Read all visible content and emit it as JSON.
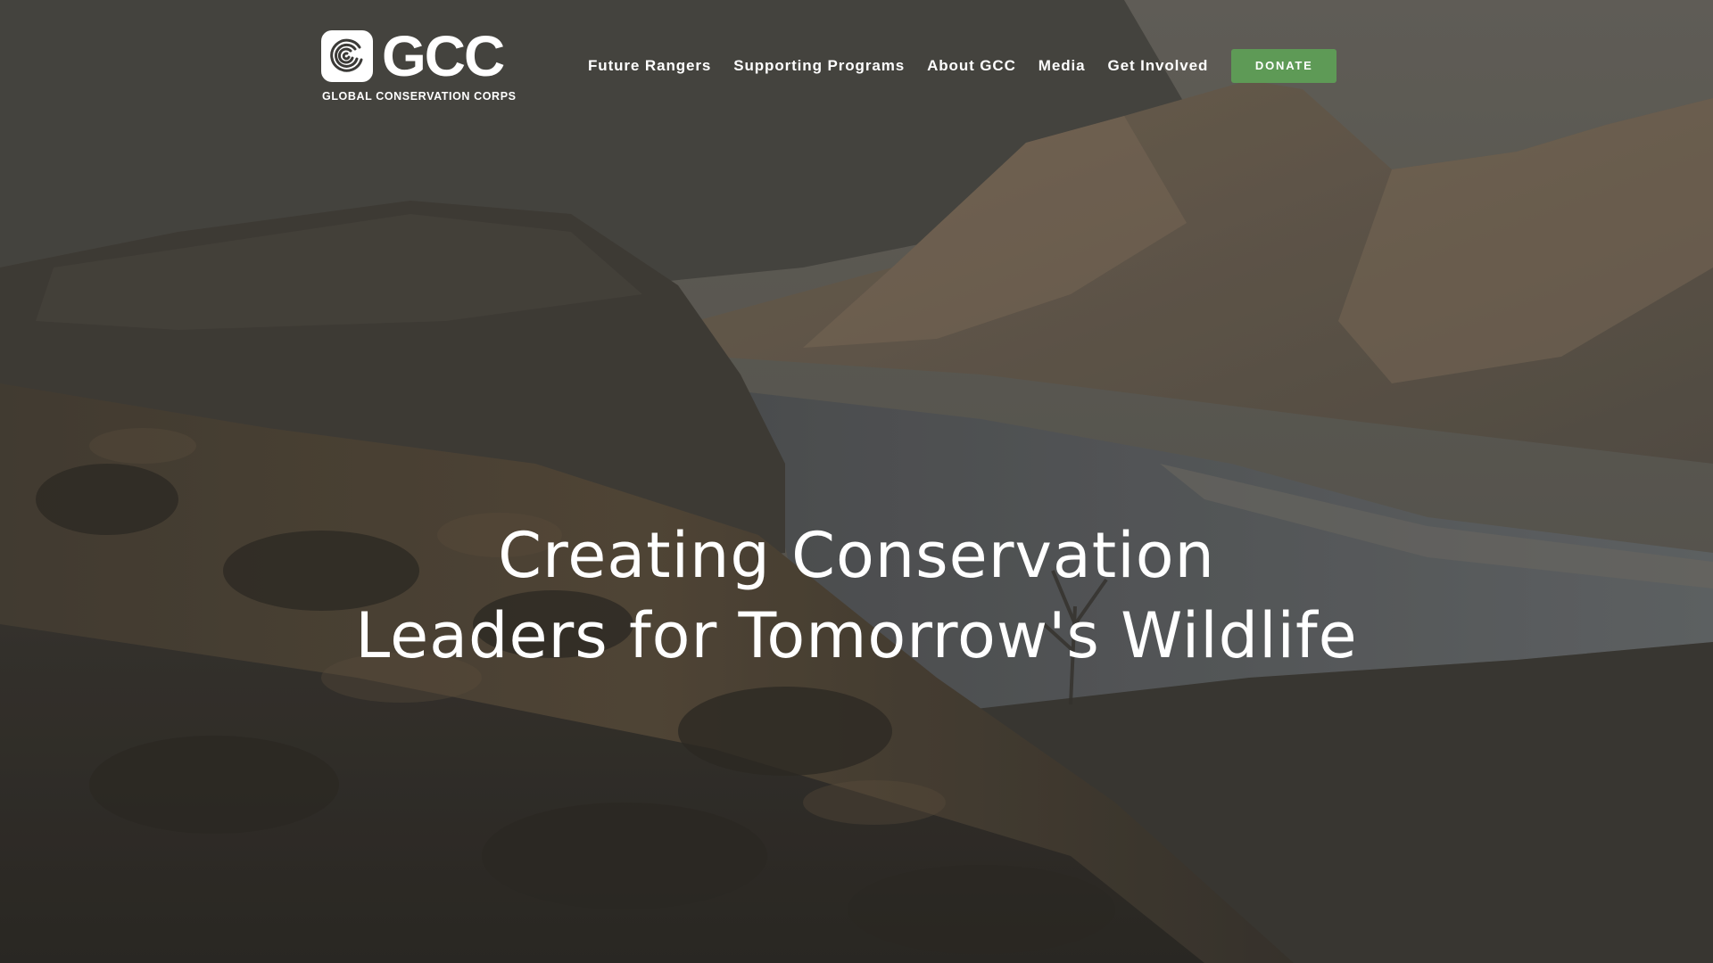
{
  "brand": {
    "logo_text": "GCC",
    "tagline": "GLOBAL CONSERVATION CORPS"
  },
  "nav": {
    "items": [
      {
        "label": "Future Rangers"
      },
      {
        "label": "Supporting Programs"
      },
      {
        "label": "About GCC"
      },
      {
        "label": "Media"
      },
      {
        "label": "Get Involved"
      }
    ],
    "donate_label": "DONATE"
  },
  "hero": {
    "headline_line1": "Creating Conservation",
    "headline_line2": "Leaders for Tomorrow's Wildlife"
  },
  "colors": {
    "accent": "#5e9a56",
    "text": "#ffffff"
  },
  "icons": {
    "logo_mark": "spiral-fingerprint-icon"
  }
}
